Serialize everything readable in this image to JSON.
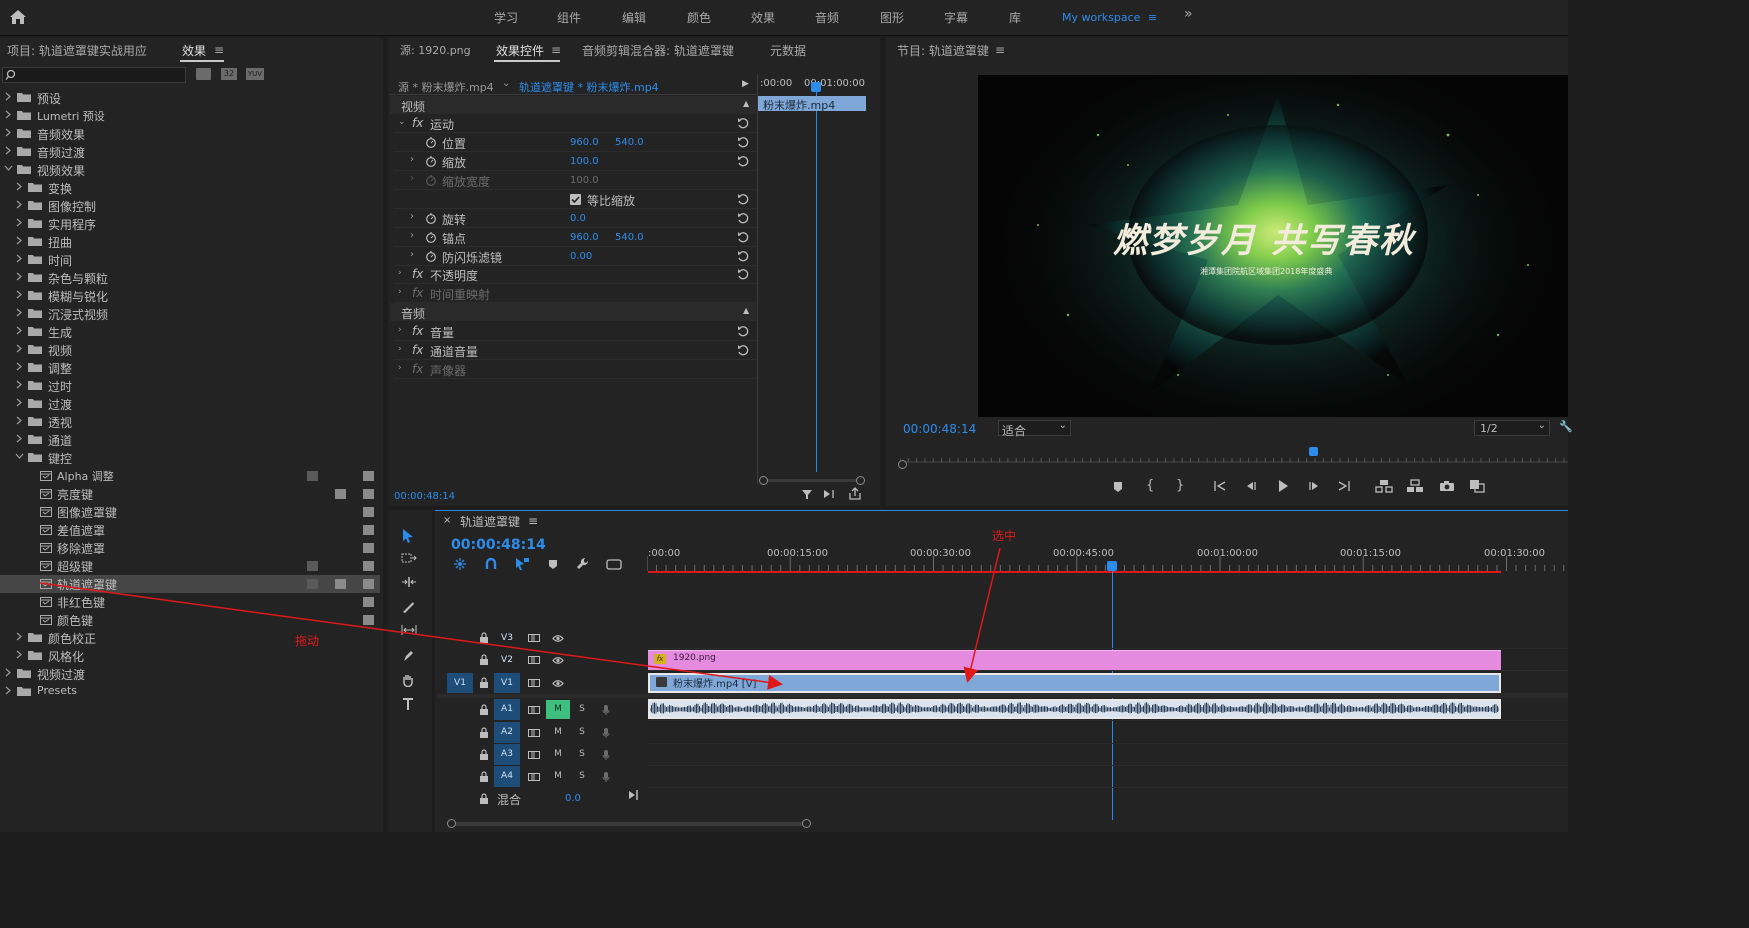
{
  "nav": {
    "home_icon": "home-icon",
    "workspaces": [
      "学习",
      "组件",
      "编辑",
      "颜色",
      "效果",
      "音频",
      "图形",
      "字幕",
      "库"
    ],
    "active_workspace": "My workspace",
    "more": "»"
  },
  "project_panel": {
    "tab_project": "项目: 轨道遮罩键实战用应",
    "tab_effects": "效果",
    "menu": "≡",
    "badges": [
      "32",
      "YUV"
    ],
    "tree": [
      {
        "label": "预设",
        "level": 0,
        "open": false
      },
      {
        "label": "Lumetri 预设",
        "level": 0,
        "open": false
      },
      {
        "label": "音频效果",
        "level": 0,
        "open": false
      },
      {
        "label": "音频过渡",
        "level": 0,
        "open": false
      },
      {
        "label": "视频效果",
        "level": 0,
        "open": true
      },
      {
        "label": "变换",
        "level": 1,
        "open": false
      },
      {
        "label": "图像控制",
        "level": 1,
        "open": false
      },
      {
        "label": "实用程序",
        "level": 1,
        "open": false
      },
      {
        "label": "扭曲",
        "level": 1,
        "open": false
      },
      {
        "label": "时间",
        "level": 1,
        "open": false
      },
      {
        "label": "杂色与颗粒",
        "level": 1,
        "open": false
      },
      {
        "label": "模糊与锐化",
        "level": 1,
        "open": false
      },
      {
        "label": "沉浸式视频",
        "level": 1,
        "open": false
      },
      {
        "label": "生成",
        "level": 1,
        "open": false
      },
      {
        "label": "视频",
        "level": 1,
        "open": false
      },
      {
        "label": "调整",
        "level": 1,
        "open": false
      },
      {
        "label": "过时",
        "level": 1,
        "open": false
      },
      {
        "label": "过渡",
        "level": 1,
        "open": false
      },
      {
        "label": "透视",
        "level": 1,
        "open": false
      },
      {
        "label": "通道",
        "level": 1,
        "open": false
      },
      {
        "label": "键控",
        "level": 1,
        "open": true
      },
      {
        "label": "Alpha 调整",
        "level": 2,
        "effect": true
      },
      {
        "label": "亮度键",
        "level": 2,
        "effect": true
      },
      {
        "label": "图像遮罩键",
        "level": 2,
        "effect": true
      },
      {
        "label": "差值遮罩",
        "level": 2,
        "effect": true
      },
      {
        "label": "移除遮罩",
        "level": 2,
        "effect": true
      },
      {
        "label": "超级键",
        "level": 2,
        "effect": true
      },
      {
        "label": "轨道遮罩键",
        "level": 2,
        "effect": true,
        "selected": true
      },
      {
        "label": "非红色键",
        "level": 2,
        "effect": true
      },
      {
        "label": "颜色键",
        "level": 2,
        "effect": true
      },
      {
        "label": "颜色校正",
        "level": 1,
        "open": false
      },
      {
        "label": "风格化",
        "level": 1,
        "open": false
      },
      {
        "label": "视频过渡",
        "level": 0,
        "open": false
      },
      {
        "label": "Presets",
        "level": 0,
        "open": false
      }
    ],
    "annotation_drag": "拖动"
  },
  "effect_controls": {
    "tabs": [
      "源: 1920.png",
      "效果控件",
      "音频剪辑混合器: 轨道遮罩键",
      "元数据"
    ],
    "source_label": "源 * 粉末爆炸.mp4",
    "sequence_label": "轨道遮罩键 * 粉末爆炸.mp4",
    "mini_times": [
      ":00:00",
      "00:01:00:00"
    ],
    "mini_clip": "粉末爆炸.mp4",
    "section_video": "视频",
    "section_audio": "音频",
    "rows": [
      {
        "label": "运动",
        "fx": true,
        "open": true
      },
      {
        "label": "位置",
        "sub": true,
        "v1": "960.0",
        "v2": "540.0"
      },
      {
        "label": "缩放",
        "sub": true,
        "v1": "100.0"
      },
      {
        "label": "缩放宽度",
        "sub": true,
        "v1": "100.0",
        "disabled": true
      },
      {
        "label": "等比缩放",
        "sub": true,
        "checkbox": true
      },
      {
        "label": "旋转",
        "sub": true,
        "v1": "0.0"
      },
      {
        "label": "锚点",
        "sub": true,
        "v1": "960.0",
        "v2": "540.0"
      },
      {
        "label": "防闪烁滤镜",
        "sub": true,
        "v1": "0.00"
      },
      {
        "label": "不透明度",
        "fx": true
      },
      {
        "label": "时间重映射",
        "fx": true,
        "disabled": true
      },
      {
        "label": "音量",
        "fx": true
      },
      {
        "label": "通道音量",
        "fx": true
      },
      {
        "label": "声像器",
        "fx": true,
        "disabled": true
      }
    ],
    "timecode": "00:00:48:14"
  },
  "program": {
    "title": "节目: 轨道遮罩键",
    "timecode": "00:00:48:14",
    "fit": "适合",
    "resolution": "1/2",
    "video_title": "燃梦岁月 共写春秋",
    "video_subtitle": "湘潭集团院航区域集团2018年度盛典"
  },
  "timeline": {
    "title": "轨道遮罩键",
    "timecode": "00:00:48:14",
    "ticks": [
      ":00:00",
      "00:00:15:00",
      "00:00:30:00",
      "00:00:45:00",
      "00:01:00:00",
      "00:01:15:00",
      "00:01:30:00"
    ],
    "annotation_selected": "选中",
    "video_tracks": [
      "V3",
      "V2",
      "V1"
    ],
    "audio_tracks": [
      "A1",
      "A2",
      "A3",
      "A4"
    ],
    "source_patch": "V1",
    "mix": "混合",
    "mix_value": "0.0",
    "clip_v2": "1920.png",
    "clip_v1": "粉末爆炸.mp4 [V]",
    "m_label": "M",
    "s_label": "S"
  },
  "colors": {
    "accent": "#2d8ceb",
    "clip_pink": "#e48be0",
    "clip_blue": "#7fa8d8",
    "annotation_red": "#e01818"
  }
}
